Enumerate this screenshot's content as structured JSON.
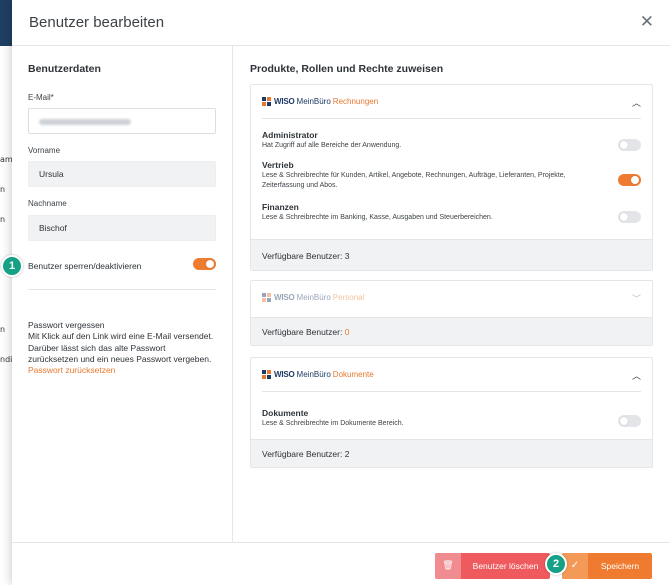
{
  "dialog": {
    "title": "Benutzer bearbeiten",
    "close_icon": "close-icon"
  },
  "background": {
    "edge_texts": [
      "ame",
      "n",
      "n",
      "n",
      "ndi"
    ]
  },
  "user_data": {
    "heading": "Benutzerdaten",
    "email_label": "E-Mail*",
    "email_value": "",
    "first_name_label": "Vorname",
    "first_name_value": "Ursula",
    "last_name_label": "Nachname",
    "last_name_value": "Bischof",
    "lock_label": "Benutzer sperren/deaktivieren",
    "lock_enabled": true
  },
  "password": {
    "title": "Passwort vergessen",
    "line1": "Mit Klick auf den Link wird eine E-Mail versendet.",
    "line2": "Darüber lässt sich das alte Passwort",
    "line3": "zurücksetzen und ein neues Passwort vergeben.",
    "link": "Passwort zurücksetzen"
  },
  "products": {
    "heading": "Produkte, Rollen und Rechte zuweisen",
    "available_label": "Verfügbare Benutzer:",
    "items": [
      {
        "brand": "WISO",
        "brand2": "MeinBüro",
        "product": "Rechnungen",
        "expanded": true,
        "available": "3",
        "roles": [
          {
            "name": "Administrator",
            "desc1": "Hat Zugriff auf alle Bereiche der Anwendung.",
            "desc2": "",
            "enabled": false
          },
          {
            "name": "Vertrieb",
            "desc1": "Lese & Schreibrechte für Kunden, Artikel, Angebote, Rechnungen, Aufträge, Lieferanten, Projekte,",
            "desc2": "Zeiterfassung und Abos.",
            "enabled": true
          },
          {
            "name": "Finanzen",
            "desc1": "Lese & Schreibrechte im Banking, Kasse, Ausgaben und Steuerbereichen.",
            "desc2": "",
            "enabled": false
          }
        ]
      },
      {
        "brand": "WISO",
        "brand2": "MeinBüro",
        "product": "Personal",
        "expanded": false,
        "available": "0",
        "roles": []
      },
      {
        "brand": "WISO",
        "brand2": "MeinBüro",
        "product": "Dokumente",
        "expanded": true,
        "available": "2",
        "roles": [
          {
            "name": "Dokumente",
            "desc1": "Lese & Schreibrechte im Dokumente Bereich.",
            "desc2": "",
            "enabled": false
          }
        ]
      }
    ]
  },
  "footer": {
    "delete_label": "Benutzer löschen",
    "delete_icon": "trash-icon",
    "save_label": "Speichern",
    "save_icon": "checkmark-icon"
  },
  "markers": [
    "1",
    "2"
  ],
  "colors": {
    "accent": "#ee7b30",
    "danger": "#ee5a5d",
    "brand_navy": "#1d3a63",
    "marker": "#16a085"
  }
}
